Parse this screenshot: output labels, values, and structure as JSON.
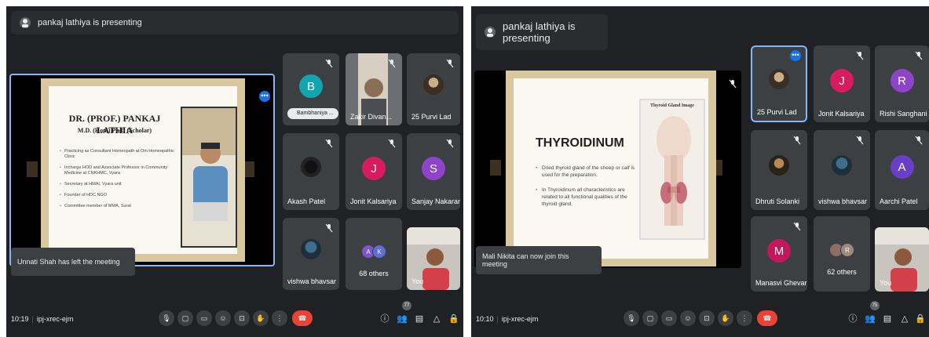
{
  "left": {
    "presenting_label": "pankaj lathiya is presenting",
    "slide": {
      "title": "DR. (PROF.) PANKAJ LATHIA",
      "subtitle": "M.D. (Hom) Ph.D (Scholar)",
      "bullets": [
        "Practicing as Consultant Homeopath at Om Homeopathic Clinic",
        "Incharge HOD and Associate Professor in Community Medicine at CNKHMC, Vyara",
        "Secretary at HMAI, Vyara unit",
        "Founder of HDC NGO",
        "Committee member of MMA, Surat"
      ]
    },
    "tiles": [
      {
        "name": "Bambhaniya ...",
        "initial": "B",
        "color": "#12a4af"
      },
      {
        "name": "Zakir Divan...",
        "initial": "",
        "color": ""
      },
      {
        "name": "25 Purvi Lad",
        "initial": "",
        "color": ""
      },
      {
        "name": "Akash Patel",
        "initial": "",
        "color": ""
      },
      {
        "name": "Jonit Kalsariya",
        "initial": "J",
        "color": "#d81b60"
      },
      {
        "name": "Sanjay Nakarani",
        "initial": "S",
        "color": "#8e44c9"
      },
      {
        "name": "vishwa bhavsar",
        "initial": "",
        "color": ""
      },
      {
        "name": "You",
        "initial": "",
        "color": ""
      }
    ],
    "others": {
      "label": "68 others",
      "avatars": [
        {
          "initial": "A",
          "color": "#7b58c8"
        },
        {
          "initial": "K",
          "color": "#5e6ed6"
        }
      ]
    },
    "toast": "Unnati Shah has left the meeting",
    "time": "10:19",
    "meeting_code": "ipj-xrec-ejm",
    "participants_badge": "77"
  },
  "right": {
    "presenting_label": "pankaj lathiya is presenting",
    "slide": {
      "title": "THYROIDINUM",
      "bullets": [
        "Dried thyroid gland of the sheep or calf is used for the preparation.",
        "In Thyroidinum all characteristics are related to all functional qualities of the thyroid gland."
      ],
      "diagram_title": "Thyroid Gland Image"
    },
    "tiles": [
      {
        "name": "25 Purvi Lad",
        "initial": "",
        "color": ""
      },
      {
        "name": "Jonit Kalsariya",
        "initial": "J",
        "color": "#d81b60"
      },
      {
        "name": "Rishi Sanghani",
        "initial": "R",
        "color": "#8e44c9"
      },
      {
        "name": "Dhruti Solanki",
        "initial": "",
        "color": ""
      },
      {
        "name": "vishwa bhavsar",
        "initial": "",
        "color": ""
      },
      {
        "name": "Aarchi Patel",
        "initial": "A",
        "color": "#6a3fc8"
      },
      {
        "name": "Manasvi Ghevari...",
        "initial": "M",
        "color": "#c2185b"
      },
      {
        "name": "You",
        "initial": "",
        "color": ""
      }
    ],
    "others": {
      "label": "62 others",
      "avatars": [
        {
          "initial": "",
          "color": "#8d6e63"
        },
        {
          "initial": "R",
          "color": "#a1887f"
        }
      ]
    },
    "toast": "Mali Nikita can now join this meeting",
    "time": "10:10",
    "meeting_code": "ipj-xrec-ejm",
    "participants_badge": "75"
  }
}
